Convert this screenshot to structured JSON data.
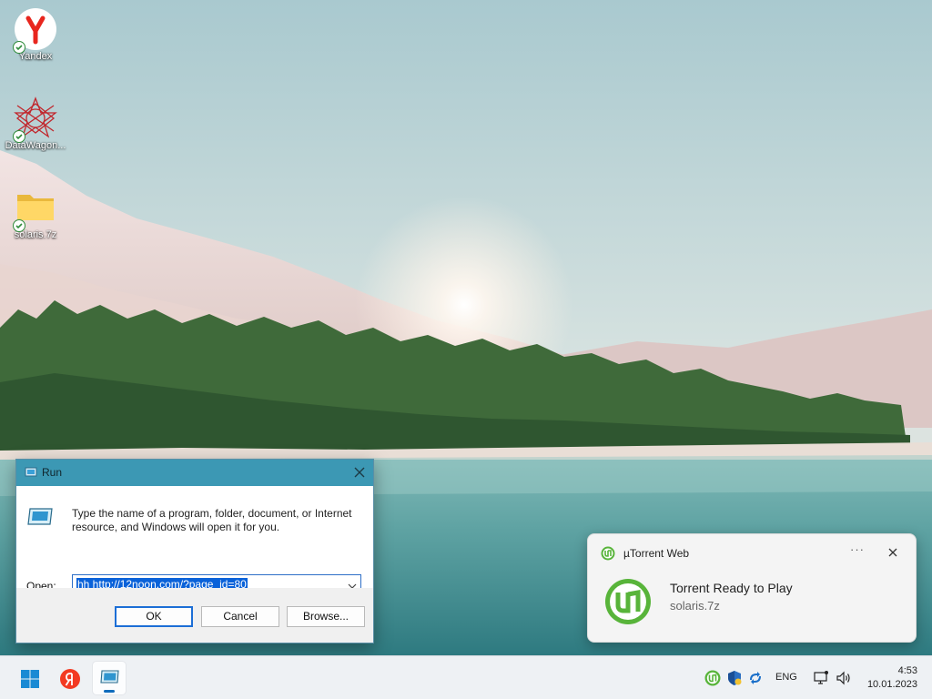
{
  "desktop": {
    "icons": [
      {
        "label": "Yandex"
      },
      {
        "label": "DataWagon..."
      },
      {
        "label": "solaris.7z"
      }
    ]
  },
  "run_dialog": {
    "title": "Run",
    "description": "Type the name of a program, folder, document, or Internet resource, and Windows will open it for you.",
    "open_label": "Open:",
    "open_value": "hh http://12noon.com/?page_id=80",
    "buttons": {
      "ok": "OK",
      "cancel": "Cancel",
      "browse": "Browse..."
    }
  },
  "notification": {
    "app_name": "µTorrent Web",
    "more_label": "···",
    "title": "Torrent Ready to Play",
    "body": "solaris.7z"
  },
  "taskbar": {
    "apps": [
      "start-icon",
      "yandex-browser-icon",
      "run-icon"
    ],
    "tray": {
      "language": "ENG",
      "time": "4:53",
      "date": "10.01.2023"
    }
  },
  "colors": {
    "run_titlebar": "#3c98b4",
    "accent": "#0f6cbd",
    "utorrent_green": "#58b43a"
  }
}
